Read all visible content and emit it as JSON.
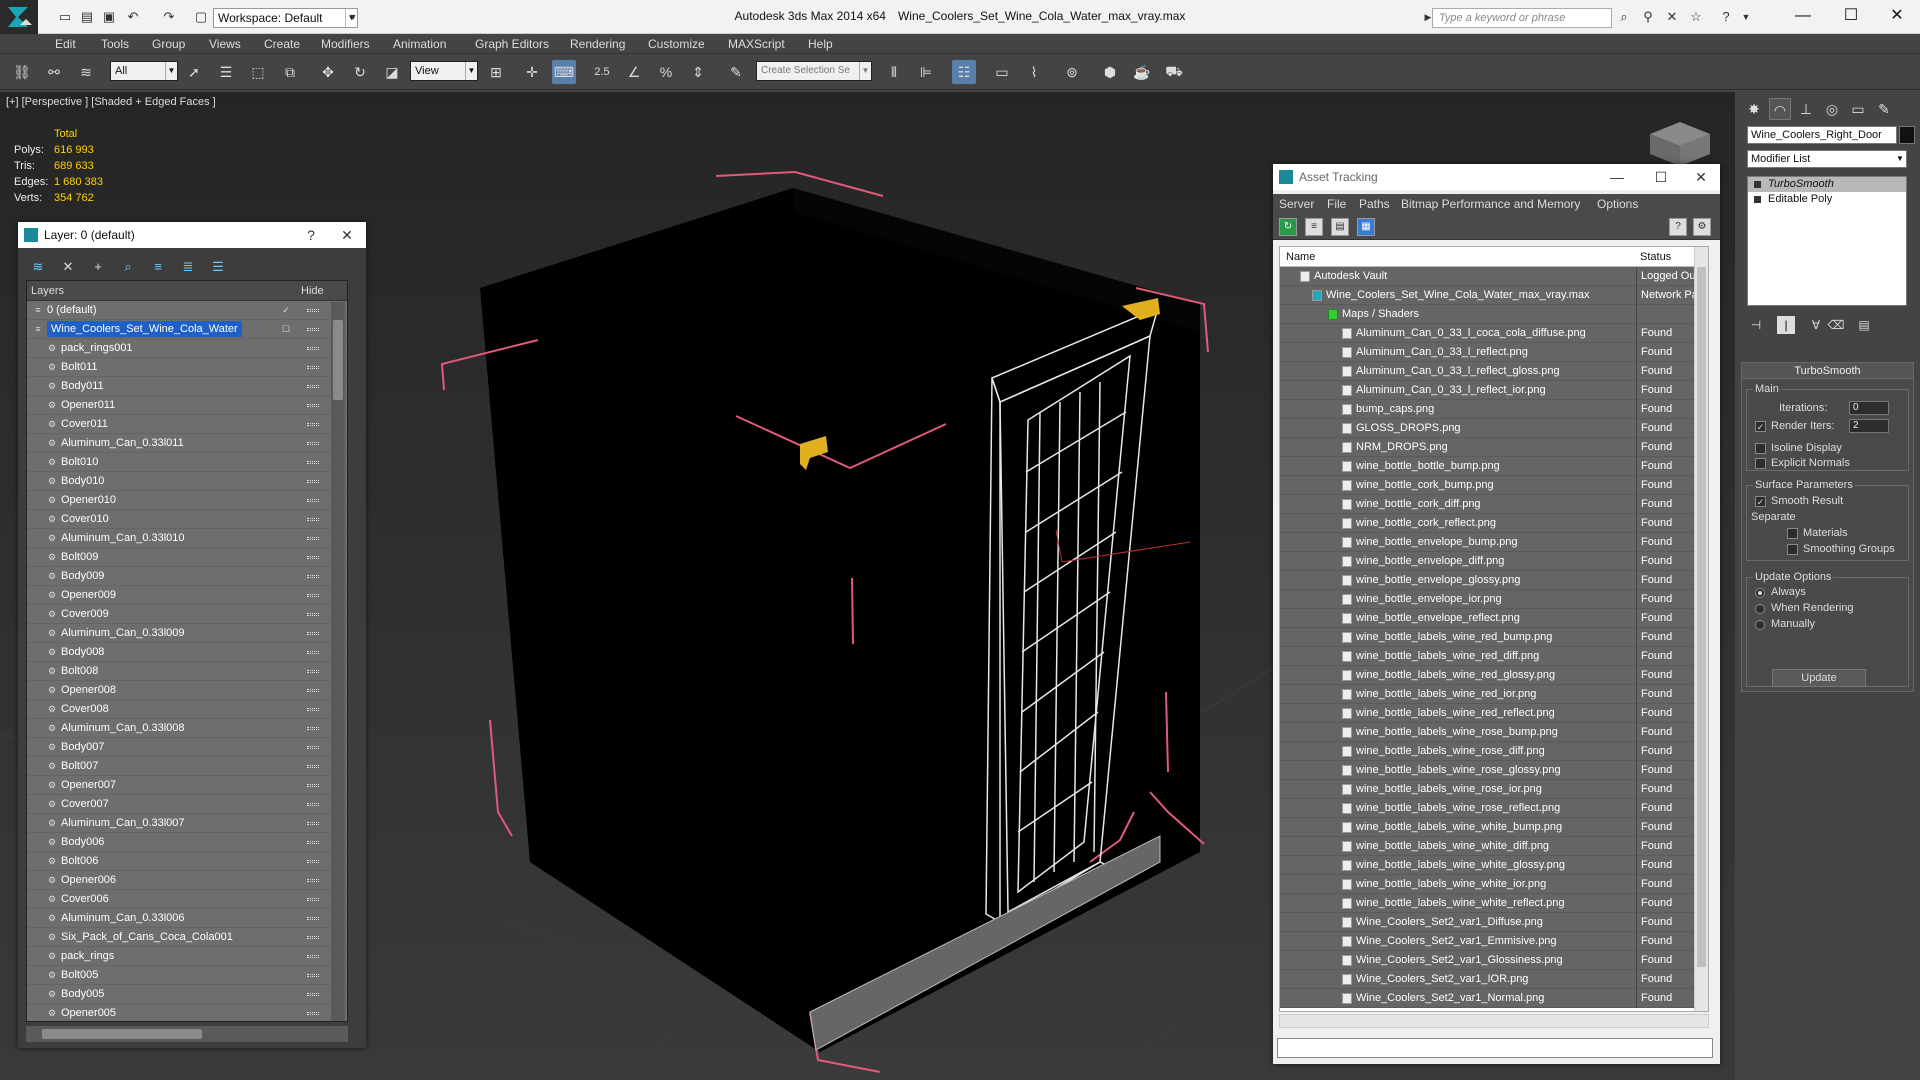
{
  "titlebar": {
    "app_title": "Autodesk 3ds Max  2014 x64",
    "file_title": "Wine_Coolers_Set_Wine_Cola_Water_max_vray.max",
    "workspace": "Workspace: Default",
    "search_placeholder": "Type a keyword or phrase"
  },
  "menu": [
    "Edit",
    "Tools",
    "Group",
    "Views",
    "Create",
    "Modifiers",
    "Animation",
    "Graph Editors",
    "Rendering",
    "Customize",
    "MAXScript",
    "Help"
  ],
  "toolbar": {
    "filter": "All",
    "ref_coord": "View",
    "snap_angle": "2.5",
    "selection_set_placeholder": "Create Selection Se"
  },
  "viewport": {
    "label": "[+] [Perspective ] [Shaded + Edged Faces ]",
    "stats": {
      "header": "Total",
      "polys_label": "Polys:",
      "polys": "616 993",
      "tris_label": "Tris:",
      "tris": "689 633",
      "edges_label": "Edges:",
      "edges": "1 680 383",
      "verts_label": "Verts:",
      "verts": "354 762"
    }
  },
  "layer_panel": {
    "title": "Layer: 0 (default)",
    "help": "?",
    "col_layers": "Layers",
    "col_hide": "Hide",
    "rows": [
      {
        "name": "0 (default)",
        "level": 0
      },
      {
        "name": "Wine_Coolers_Set_Wine_Cola_Water",
        "level": 0,
        "selected": true
      },
      {
        "name": "pack_rings001",
        "level": 1
      },
      {
        "name": "Bolt011",
        "level": 1
      },
      {
        "name": "Body011",
        "level": 1
      },
      {
        "name": "Opener011",
        "level": 1
      },
      {
        "name": "Cover011",
        "level": 1
      },
      {
        "name": "Aluminum_Can_0.33l011",
        "level": 1
      },
      {
        "name": "Bolt010",
        "level": 1
      },
      {
        "name": "Body010",
        "level": 1
      },
      {
        "name": "Opener010",
        "level": 1
      },
      {
        "name": "Cover010",
        "level": 1
      },
      {
        "name": "Aluminum_Can_0.33l010",
        "level": 1
      },
      {
        "name": "Bolt009",
        "level": 1
      },
      {
        "name": "Body009",
        "level": 1
      },
      {
        "name": "Opener009",
        "level": 1
      },
      {
        "name": "Cover009",
        "level": 1
      },
      {
        "name": "Aluminum_Can_0.33l009",
        "level": 1
      },
      {
        "name": "Body008",
        "level": 1
      },
      {
        "name": "Bolt008",
        "level": 1
      },
      {
        "name": "Opener008",
        "level": 1
      },
      {
        "name": "Cover008",
        "level": 1
      },
      {
        "name": "Aluminum_Can_0.33l008",
        "level": 1
      },
      {
        "name": "Body007",
        "level": 1
      },
      {
        "name": "Bolt007",
        "level": 1
      },
      {
        "name": "Opener007",
        "level": 1
      },
      {
        "name": "Cover007",
        "level": 1
      },
      {
        "name": "Aluminum_Can_0.33l007",
        "level": 1
      },
      {
        "name": "Body006",
        "level": 1
      },
      {
        "name": "Bolt006",
        "level": 1
      },
      {
        "name": "Opener006",
        "level": 1
      },
      {
        "name": "Cover006",
        "level": 1
      },
      {
        "name": "Aluminum_Can_0.33l006",
        "level": 1
      },
      {
        "name": "Six_Pack_of_Cans_Coca_Cola001",
        "level": 1
      },
      {
        "name": "pack_rings",
        "level": 1
      },
      {
        "name": "Bolt005",
        "level": 1
      },
      {
        "name": "Body005",
        "level": 1
      },
      {
        "name": "Opener005",
        "level": 1
      }
    ]
  },
  "asset_panel": {
    "title": "Asset Tracking",
    "menu": [
      "Server",
      "File",
      "Paths",
      "Bitmap Performance and Memory",
      "Options"
    ],
    "col_name": "Name",
    "col_status": "Status",
    "rows": [
      {
        "name": "Autodesk Vault",
        "status": "Logged Out",
        "level": 0
      },
      {
        "name": "Wine_Coolers_Set_Wine_Cola_Water_max_vray.max",
        "status": "Network Pa",
        "level": 1
      },
      {
        "name": "Maps / Shaders",
        "status": "",
        "level": 2
      },
      {
        "name": "Aluminum_Can_0_33_l_coca_cola_diffuse.png",
        "status": "Found",
        "level": 3
      },
      {
        "name": "Aluminum_Can_0_33_l_reflect.png",
        "status": "Found",
        "level": 3
      },
      {
        "name": "Aluminum_Can_0_33_l_reflect_gloss.png",
        "status": "Found",
        "level": 3
      },
      {
        "name": "Aluminum_Can_0_33_l_reflect_ior.png",
        "status": "Found",
        "level": 3
      },
      {
        "name": "bump_caps.png",
        "status": "Found",
        "level": 3
      },
      {
        "name": "GLOSS_DROPS.png",
        "status": "Found",
        "level": 3
      },
      {
        "name": "NRM_DROPS.png",
        "status": "Found",
        "level": 3
      },
      {
        "name": "wine_bottle_bottle_bump.png",
        "status": "Found",
        "level": 3
      },
      {
        "name": "wine_bottle_cork_bump.png",
        "status": "Found",
        "level": 3
      },
      {
        "name": "wine_bottle_cork_diff.png",
        "status": "Found",
        "level": 3
      },
      {
        "name": "wine_bottle_cork_reflect.png",
        "status": "Found",
        "level": 3
      },
      {
        "name": "wine_bottle_envelope_bump.png",
        "status": "Found",
        "level": 3
      },
      {
        "name": "wine_bottle_envelope_diff.png",
        "status": "Found",
        "level": 3
      },
      {
        "name": "wine_bottle_envelope_glossy.png",
        "status": "Found",
        "level": 3
      },
      {
        "name": "wine_bottle_envelope_ior.png",
        "status": "Found",
        "level": 3
      },
      {
        "name": "wine_bottle_envelope_reflect.png",
        "status": "Found",
        "level": 3
      },
      {
        "name": "wine_bottle_labels_wine_red_bump.png",
        "status": "Found",
        "level": 3
      },
      {
        "name": "wine_bottle_labels_wine_red_diff.png",
        "status": "Found",
        "level": 3
      },
      {
        "name": "wine_bottle_labels_wine_red_glossy.png",
        "status": "Found",
        "level": 3
      },
      {
        "name": "wine_bottle_labels_wine_red_ior.png",
        "status": "Found",
        "level": 3
      },
      {
        "name": "wine_bottle_labels_wine_red_reflect.png",
        "status": "Found",
        "level": 3
      },
      {
        "name": "wine_bottle_labels_wine_rose_bump.png",
        "status": "Found",
        "level": 3
      },
      {
        "name": "wine_bottle_labels_wine_rose_diff.png",
        "status": "Found",
        "level": 3
      },
      {
        "name": "wine_bottle_labels_wine_rose_glossy.png",
        "status": "Found",
        "level": 3
      },
      {
        "name": "wine_bottle_labels_wine_rose_ior.png",
        "status": "Found",
        "level": 3
      },
      {
        "name": "wine_bottle_labels_wine_rose_reflect.png",
        "status": "Found",
        "level": 3
      },
      {
        "name": "wine_bottle_labels_wine_white_bump.png",
        "status": "Found",
        "level": 3
      },
      {
        "name": "wine_bottle_labels_wine_white_diff.png",
        "status": "Found",
        "level": 3
      },
      {
        "name": "wine_bottle_labels_wine_white_glossy.png",
        "status": "Found",
        "level": 3
      },
      {
        "name": "wine_bottle_labels_wine_white_ior.png",
        "status": "Found",
        "level": 3
      },
      {
        "name": "wine_bottle_labels_wine_white_reflect.png",
        "status": "Found",
        "level": 3
      },
      {
        "name": "Wine_Coolers_Set2_var1_Diffuse.png",
        "status": "Found",
        "level": 3
      },
      {
        "name": "Wine_Coolers_Set2_var1_Emmisive.png",
        "status": "Found",
        "level": 3
      },
      {
        "name": "Wine_Coolers_Set2_var1_Glossiness.png",
        "status": "Found",
        "level": 3
      },
      {
        "name": "Wine_Coolers_Set2_var1_IOR.png",
        "status": "Found",
        "level": 3
      },
      {
        "name": "Wine_Coolers_Set2_var1_Normal.png",
        "status": "Found",
        "level": 3
      }
    ]
  },
  "command_panel": {
    "object_name": "Wine_Coolers_Right_Door",
    "modifier_list": "Modifier List",
    "stack": [
      "TurboSmooth",
      "Editable Poly"
    ],
    "rollout_title": "TurboSmooth",
    "main_group": "Main",
    "iterations_label": "Iterations:",
    "iterations": "0",
    "render_iters_label": "Render Iters:",
    "render_iters": "2",
    "isoline": "Isoline Display",
    "explicit_normals": "Explicit Normals",
    "surface_group": "Surface Parameters",
    "smooth_result": "Smooth Result",
    "separate": "Separate",
    "materials": "Materials",
    "smoothing_groups": "Smoothing Groups",
    "update_group": "Update Options",
    "always": "Always",
    "when_rendering": "When Rendering",
    "manually": "Manually",
    "update_button": "Update"
  },
  "colors": {
    "accent": "#1e5fc8",
    "stats_yellow": "#ffd000",
    "selection_bracket": "#e05a7a"
  }
}
